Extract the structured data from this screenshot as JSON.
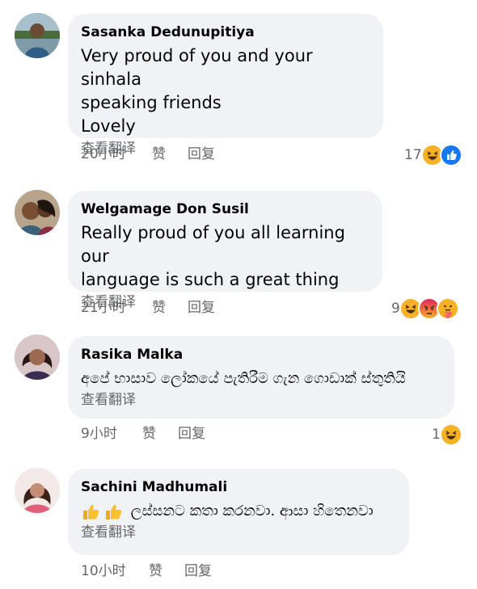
{
  "colors": {
    "bubble": "#f0f2f5",
    "secondary_text": "#65676b",
    "primary_text": "#050505",
    "like_blue": "#1877f2",
    "haha_yellow": "#f7b125",
    "angry_red": "#e9710f"
  },
  "comments": [
    {
      "author": "Sasanka Dedunupitiya",
      "text": "Very proud of you and your sinhala\nspeaking friends\nLovely",
      "translate": "查看翻译",
      "time": "20小时",
      "like": "赞",
      "reply": "回复",
      "reaction_count": "17",
      "reactions": [
        "haha-icon",
        "like-icon"
      ]
    },
    {
      "author": "Welgamage Don Susil",
      "text": "Really proud of you all learning our\nlanguage is such a great thing",
      "translate": "查看翻译",
      "time": "21小时",
      "like": "赞",
      "reply": "回复",
      "reaction_count": "9",
      "reactions": [
        "haha-icon",
        "angry-icon",
        "care-icon"
      ]
    },
    {
      "author": "Rasika Malka",
      "text": "අපේ භාසාව ලෝකයේ පැතිරීම ගැන ගොඩාක්  ස්තුතියි",
      "translate": "查看翻译",
      "time": "9小时",
      "like": "赞",
      "reply": "回复",
      "reaction_count": "1",
      "reactions": [
        "haha-icon"
      ]
    },
    {
      "author": "Sachini Madhumali",
      "text": "ලස්සනට කතා කරනවා. ආසා හිතෙනවා",
      "emoji_prefix": [
        "thumbs-up-emoji",
        "thumbs-up-emoji"
      ],
      "translate": "查看翻译",
      "time": "10小时",
      "like": "赞",
      "reply": "回复"
    }
  ]
}
